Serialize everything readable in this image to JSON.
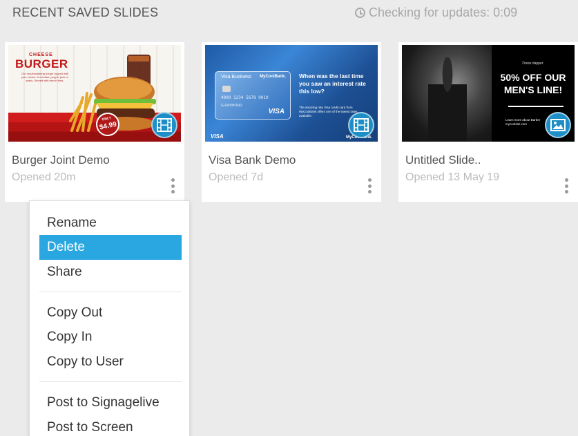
{
  "header": {
    "title": "RECENT SAVED SLIDES",
    "update_status": "Checking for updates: 0:09"
  },
  "cards": [
    {
      "name": "Burger Joint Demo",
      "opened": "Opened 20m",
      "badge_icon": "film-icon",
      "thumb": {
        "small_heading": "CHEESE",
        "heading": "BURGER",
        "copy": "Our mouthwatering burger topped with your choice of cheddar, pepper jack or swiss. Served with french fries.",
        "price_prefix": "ONLY",
        "price": "$4.99"
      }
    },
    {
      "name": "Visa Bank Demo",
      "opened": "Opened 7d",
      "badge_icon": "film-icon",
      "thumb": {
        "card_label": "Visa Business",
        "card_bank": "MyCoolBank.",
        "card_number": "4000 1234 5678 9010",
        "card_name": "G.RAYMOND",
        "card_brand": "VISA",
        "headline": "When was the last time you saw an interest rate this low?",
        "body": "The amazing rate Visa credit card from MyCoolBank offers one of the lowest rates available.",
        "footer_left": "VISA",
        "footer_right": "MyCoolBank."
      }
    },
    {
      "name": "Untitled Slide..",
      "opened": "Opened 13 May 19",
      "badge_icon": "image-icon",
      "thumb": {
        "small": "Dress dapper.",
        "headline": "50% OFF OUR MEN'S LINE!",
        "learn": "Learn more about Barber mycoolsite.com"
      }
    }
  ],
  "menu": {
    "group1": [
      "Rename",
      "Delete",
      "Share"
    ],
    "group2": [
      "Copy Out",
      "Copy In",
      "Copy to User"
    ],
    "group3": [
      "Post to Signagelive",
      "Post to Screen"
    ],
    "active_item": "Delete"
  },
  "colors": {
    "accent": "#2aa7e0",
    "badge": "#1e8fc6",
    "background": "#ebebeb"
  }
}
